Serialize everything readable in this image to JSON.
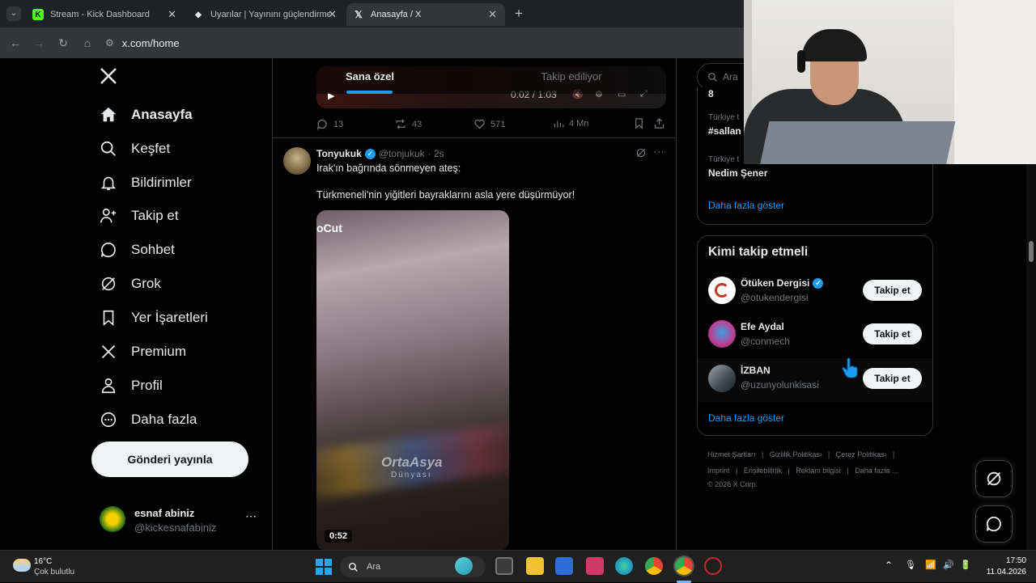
{
  "browser": {
    "tabs": [
      {
        "title": "Stream - Kick Dashboard",
        "favicon": "K",
        "color": "#53fc18"
      },
      {
        "title": "Uyarılar | Yayınını güçlendirmek",
        "favicon": "◆",
        "color": "#e8eaed"
      },
      {
        "title": "Anasayfa / X",
        "favicon": "𝕏",
        "color": "#e8eaed"
      }
    ],
    "url": "x.com/home"
  },
  "nav": {
    "items": [
      {
        "label": "Anasayfa",
        "icon": "home-icon"
      },
      {
        "label": "Keşfet",
        "icon": "search-icon"
      },
      {
        "label": "Bildirimler",
        "icon": "bell-icon"
      },
      {
        "label": "Takip et",
        "icon": "person-add-icon"
      },
      {
        "label": "Sohbet",
        "icon": "chat-icon"
      },
      {
        "label": "Grok",
        "icon": "grok-icon"
      },
      {
        "label": "Yer İşaretleri",
        "icon": "bookmark-icon"
      },
      {
        "label": "Premium",
        "icon": "x-logo-icon"
      },
      {
        "label": "Profil",
        "icon": "person-icon"
      },
      {
        "label": "Daha fazla",
        "icon": "more-circle-icon"
      }
    ],
    "post_button": "Gönderi yayınla",
    "account": {
      "name": "esnaf abiniz",
      "handle": "@kickesnafabiniz"
    }
  },
  "feed": {
    "tabs": [
      "Sana özel",
      "Takip ediliyor"
    ],
    "player_time": "0:02 / 1:03",
    "prev_stats": {
      "replies": "13",
      "reposts": "43",
      "likes": "571",
      "views": "4 Mn"
    },
    "tweet": {
      "name": "Tonyukuk",
      "handle": "@tonjukuk",
      "time": "· 2s",
      "line1": "Irak'ın bağrında sönmeyen ateş:",
      "line2": "Türkmeneli'nin yiğitleri bayraklarını asla yere düşürmüyor!",
      "video_overlay": "oCut",
      "watermark_1": "OrtaAsya",
      "watermark_2": "Dünyası",
      "duration": "0:52"
    }
  },
  "right": {
    "search_placeholder": "Ara",
    "trends": [
      {
        "meta": "Türkiye t",
        "title": "#sallan"
      },
      {
        "meta": "Türkiye t",
        "title": "Nedim Şener"
      }
    ],
    "trends_more": "Daha fazla göster",
    "who_to_follow": {
      "title": "Kimi takip etmeli",
      "button": "Takip et",
      "more": "Daha fazla göster",
      "users": [
        {
          "name": "Ötüken Dergisi",
          "handle": "@otukendergisi",
          "verified": true
        },
        {
          "name": "Efe Aydal",
          "handle": "@conmech",
          "verified": false
        },
        {
          "name": "İZBAN",
          "handle": "@uzunyolunkisasi",
          "verified": false
        }
      ]
    },
    "footer": {
      "l1": [
        "Hizmet Şartları",
        "|",
        "Gizlilik Politikası",
        "|",
        "Çerez Politikası",
        "|"
      ],
      "l2": [
        "Imprint",
        "|",
        "Erişilebilirlik",
        "|",
        "Reklam bilgisi",
        "|",
        "Daha fazla ..."
      ],
      "copyright": "© 2026 X Corp."
    }
  },
  "taskbar": {
    "temp": "16°C",
    "weather": "Çok bulutlu",
    "search": "Ara",
    "time": "17:50",
    "date": "11.04.2026"
  }
}
